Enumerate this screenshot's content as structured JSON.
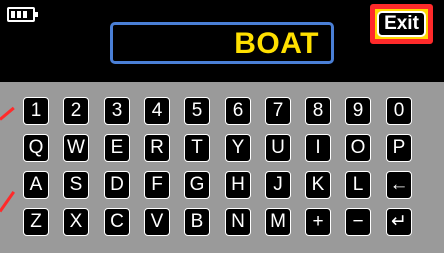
{
  "display": {
    "text": "BOAT"
  },
  "exit": {
    "label": "Exit"
  },
  "keyboard": {
    "rows": [
      [
        "1",
        "2",
        "3",
        "4",
        "5",
        "6",
        "7",
        "8",
        "9",
        "0"
      ],
      [
        "Q",
        "W",
        "E",
        "R",
        "T",
        "Y",
        "U",
        "I",
        "O",
        "P"
      ],
      [
        "A",
        "S",
        "D",
        "F",
        "G",
        "H",
        "J",
        "K",
        "L",
        "←"
      ],
      [
        "Z",
        "X",
        "C",
        "V",
        "B",
        "N",
        "M",
        "+",
        "−",
        "↵"
      ]
    ]
  },
  "colors": {
    "background": "#000000",
    "keyboard_panel": "#9a9a9a",
    "display_border": "#4a7fd6",
    "display_text": "#ffe000",
    "exit_highlight_fill": "#ffd800",
    "exit_highlight_border": "#ff2a2a"
  },
  "icons": {
    "battery": "battery-icon"
  }
}
